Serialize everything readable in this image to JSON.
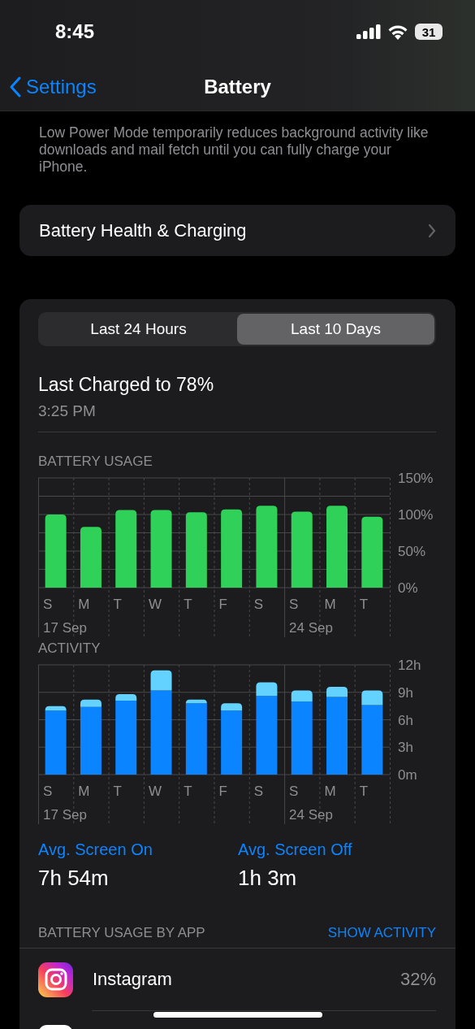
{
  "status_bar": {
    "time": "8:45",
    "battery": "31"
  },
  "nav": {
    "back": "Settings",
    "title": "Battery"
  },
  "low_power_note": "Low Power Mode temporarily reduces background activity like downloads and mail fetch until you can fully charge your iPhone.",
  "health_row": {
    "label": "Battery Health & Charging"
  },
  "segments": [
    {
      "label": "Last 24 Hours",
      "selected": false
    },
    {
      "label": "Last 10 Days",
      "selected": true
    }
  ],
  "last_charged": {
    "title": "Last Charged to 78%",
    "time": "3:25 PM"
  },
  "battery_usage": {
    "heading": "BATTERY USAGE",
    "date_labels": [
      "17 Sep",
      "24 Sep"
    ],
    "chart_data": {
      "type": "bar",
      "categories": [
        "S",
        "M",
        "T",
        "W",
        "T",
        "F",
        "S",
        "S",
        "M",
        "T"
      ],
      "series": [
        {
          "color": "#30d158",
          "values": [
            100,
            83,
            106,
            106,
            103,
            107,
            112,
            104,
            112,
            97
          ]
        }
      ],
      "ylim": [
        0,
        150
      ],
      "grid": true,
      "yticks": [
        {
          "value": 0,
          "label": "0%"
        },
        {
          "value": 50,
          "label": "50%"
        },
        {
          "value": 100,
          "label": "100%"
        },
        {
          "value": 150,
          "label": "150%"
        }
      ]
    }
  },
  "activity": {
    "heading": "ACTIVITY",
    "date_labels": [
      "17 Sep",
      "24 Sep"
    ],
    "chart_data": {
      "type": "bar",
      "stacked": true,
      "categories": [
        "S",
        "M",
        "T",
        "W",
        "T",
        "F",
        "S",
        "S",
        "M",
        "T"
      ],
      "series": [
        {
          "color": "#0a84ff",
          "values": [
            7.0,
            7.4,
            8.1,
            9.2,
            7.8,
            7.0,
            8.6,
            8.0,
            8.5,
            7.6
          ]
        },
        {
          "color": "#64d2ff",
          "values": [
            0.5,
            0.8,
            0.7,
            2.2,
            0.4,
            0.8,
            1.5,
            1.2,
            1.1,
            1.6
          ]
        }
      ],
      "ylim": [
        0,
        12
      ],
      "grid": true,
      "yticks": [
        {
          "value": 0,
          "label": "0m"
        },
        {
          "value": 3,
          "label": "3h"
        },
        {
          "value": 6,
          "label": "6h"
        },
        {
          "value": 9,
          "label": "9h"
        },
        {
          "value": 12,
          "label": "12h"
        }
      ]
    }
  },
  "averages": [
    {
      "label": "Avg. Screen On",
      "value": "7h 54m"
    },
    {
      "label": "Avg. Screen Off",
      "value": "1h 3m"
    }
  ],
  "apps_section": {
    "heading": "BATTERY USAGE BY APP",
    "action": "SHOW ACTIVITY"
  },
  "apps": [
    {
      "name": "Instagram",
      "share": "32%"
    }
  ]
}
